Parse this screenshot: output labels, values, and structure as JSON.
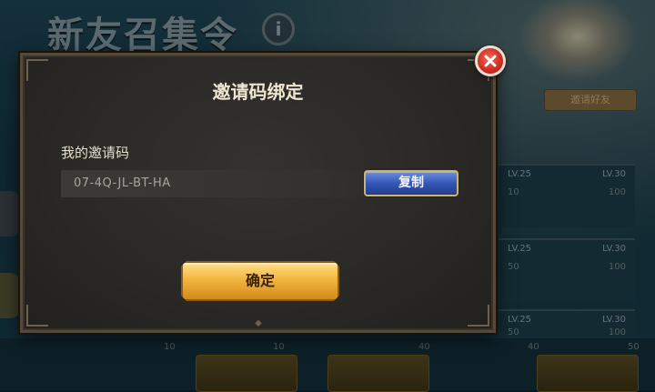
{
  "background": {
    "title": "新友召集令",
    "info_symbol": "i",
    "hero_button_label": "邀请好友",
    "level_panels": [
      {
        "left": "LV.25",
        "right": "LV.30",
        "reward_left": "10",
        "reward_right": "100"
      },
      {
        "left": "LV.25",
        "right": "LV.30",
        "reward_left": "50",
        "reward_right": "100"
      },
      {
        "left": "LV.25",
        "right": "LV.30",
        "reward_left": "50",
        "reward_right": "100"
      }
    ],
    "bottom_values": [
      "10",
      "10",
      "40",
      "40",
      "50"
    ]
  },
  "dialog": {
    "title": "邀请码绑定",
    "field_label": "我的邀请码",
    "invite_code": "07-4Q-JL-BT-HA",
    "copy_button_label": "复制",
    "confirm_button_label": "确定",
    "close_icon": "close-x-icon"
  },
  "colors": {
    "copy_button": "#3656b5",
    "confirm_button": "#f3b63f",
    "close_button": "#d32f24",
    "dialog_bg": "#2a2825"
  }
}
